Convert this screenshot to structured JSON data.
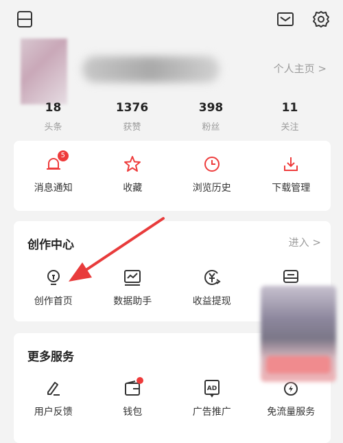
{
  "profile": {
    "home_link": "个人主页 >"
  },
  "stats": [
    {
      "num": "18",
      "label": "头条"
    },
    {
      "num": "1376",
      "label": "获赞"
    },
    {
      "num": "398",
      "label": "粉丝"
    },
    {
      "num": "11",
      "label": "关注"
    }
  ],
  "quick": {
    "notifications": {
      "label": "消息通知",
      "badge": "5"
    },
    "favorites": {
      "label": "收藏"
    },
    "history": {
      "label": "浏览历史"
    },
    "downloads": {
      "label": "下载管理"
    }
  },
  "creation": {
    "title": "创作中心",
    "enter": "进入 >",
    "items": {
      "creator_home": "创作首页",
      "data_assistant": "数据助手",
      "earnings": "收益提现"
    }
  },
  "more": {
    "title": "更多服务",
    "items": {
      "feedback": "用户反馈",
      "wallet": "钱包",
      "ads": "广告推广",
      "free_data": "免流量服务"
    }
  },
  "colors": {
    "accent": "#ee3b3b",
    "muted": "#9b9b9b"
  }
}
